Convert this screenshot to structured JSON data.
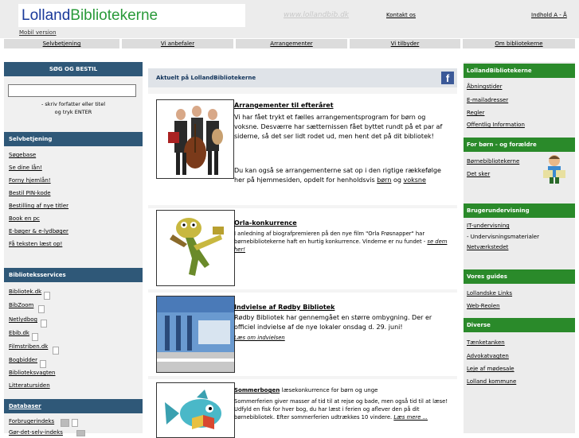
{
  "header": {
    "logo_part1": "Lolland",
    "logo_part2": "Bibliotekerne",
    "mobile": "Mobil version",
    "site_url": "www.lollandbib.dk",
    "contact": "Kontakt os",
    "index": "Indhold A - Å"
  },
  "topnav": [
    "Selvbetjening",
    "Vi anbefaler",
    "Arrangementer",
    "Vi tilbyder",
    "Om bibliotekerne"
  ],
  "search": {
    "heading": "SØG OG BESTIL",
    "hint1": "- skriv forfatter eller titel",
    "hint2": "og tryk ENTER"
  },
  "self_service": {
    "heading": "Selvbetjening",
    "items": [
      "Søgebase",
      "Se dine lån!",
      "Forny hjemlån!",
      "Bestil PIN-kode",
      "Bestilling af nye titler",
      "Book en pc",
      "E-bøger & e-lydbøger",
      "Få teksten læst op!"
    ]
  },
  "library_services": {
    "heading": "Biblioteksservices",
    "items": [
      "Bibliotek.dk",
      "BibZoom",
      "Netlydbog",
      "Ebib.dk",
      "Filmstriben.dk",
      "Bogbidder",
      "Biblioteksvagten",
      "Litteratursiden"
    ]
  },
  "databases": {
    "heading": "Databaser",
    "items": [
      "Forbrugerindeks",
      "Gør-det-selv-indeks"
    ]
  },
  "main": {
    "heading": "Aktuelt på LollandBibliotekerne",
    "fb_icon_letter": "f",
    "items": [
      {
        "title": "Arrangementer til efteråret",
        "text": "Vi har fået trykt et fælles arrangementsprogram for børn og voksne. Desværre har sætternissen fået byttet rundt på et par af siderne, så det ser lidt rodet ud, men hent det på dit bibliotek!",
        "text2_prefix": "Du kan også se arrangementerne sat op i den rigtige rækkefølge her på hjemmesiden, opdelt for henholdsvis ",
        "link_children": "børn",
        "and_word": " og ",
        "link_adults": "voksne"
      },
      {
        "title": "Orla-konkurrence",
        "text": "I anledning af biografpremieren på den nye film \"Orla Frøsnapper\" har børnebibliotekerne haft en hurtig konkurrence. Vinderne er nu fundet - ",
        "more": "se dem her!"
      },
      {
        "title": "Indvielse af Rødby Bibliotek",
        "text": "Rødby Bibliotek har gennemgået en større ombygning. Der er officiel indvielse af de nye lokaler onsdag d. 29. juni!",
        "more": "Læs om indvielsen"
      },
      {
        "title": "Sommerbogen",
        "title_suffix": " - læsekonkurrence for børn og unge",
        "text": "Sommerferien giver masser af tid til at rejse og bade, men også tid til at læse! Udfyld en fisk for hver bog, du har læst i ferien og aflever den på dit børnebibliotek. Efter sommerferien udtrækkes 10 vindere. ",
        "more": "Læs mere ..."
      }
    ]
  },
  "right": {
    "sections": [
      {
        "heading": "LollandBibliotekerne",
        "items": [
          "Åbningstider",
          "E-mailadresser",
          "Regler",
          "Offentlig Information"
        ]
      },
      {
        "heading": "For børn - og forældre",
        "items": [
          "Børnebibliotekerne",
          "Det sker"
        ]
      },
      {
        "heading": "Brugerundervisning",
        "items": [
          "IT-undervisning",
          "- Undervisningsmaterialer",
          "Netværkstedet"
        ]
      },
      {
        "heading": "Vores guides",
        "items": [
          "Lollandske Links",
          "Web-Reolen"
        ]
      },
      {
        "heading": "Diverse",
        "items": [
          "Tænketanken",
          "Advokatvagten",
          "Leje af mødesale",
          "Lolland kommune"
        ]
      }
    ]
  },
  "colors": {
    "left_heading": "#2f5878",
    "right_heading": "#2a8a2a",
    "logo_blue": "#1a3a9a",
    "logo_green": "#2a9a3a"
  }
}
